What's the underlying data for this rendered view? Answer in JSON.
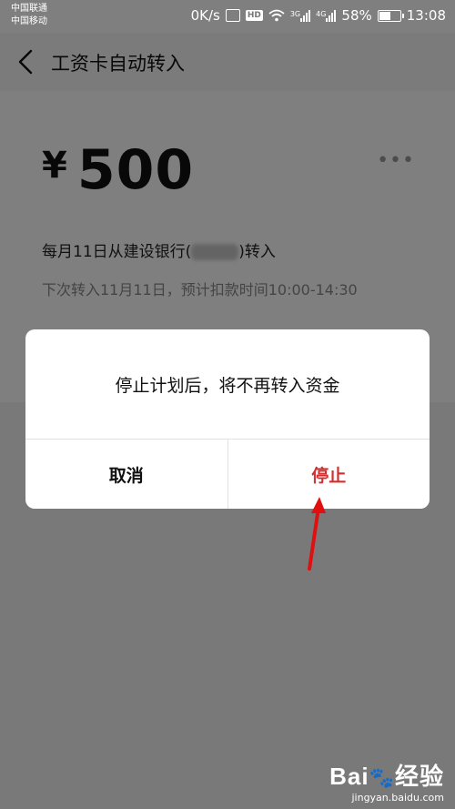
{
  "status_bar": {
    "carrier_1": "中国联通",
    "carrier_2": "中国移动",
    "net_speed": "0K/s",
    "hd_label": "HD",
    "sig1_label": "3G",
    "sig2_label": "4G",
    "battery_percent": "58%",
    "time": "13:08",
    "icons": [
      "vibrate-icon",
      "hd-icon",
      "wifi-icon",
      "signal-3g-icon",
      "signal-4g-icon",
      "battery-icon"
    ]
  },
  "navbar": {
    "back_icon": "chevron-left-icon",
    "title": "工资卡自动转入"
  },
  "plan": {
    "currency": "¥",
    "amount": "500",
    "more_label": "•••",
    "desc_prefix": "每月11日从建设银行(",
    "desc_suffix": ")转入",
    "next_info": "下次转入11月11日，预计扣款时间10:00-14:30"
  },
  "dialog": {
    "message": "停止计划后，将不再转入资金",
    "cancel_label": "取消",
    "stop_label": "停止"
  },
  "watermark": {
    "logo_text": "Bai",
    "logo_suffix": "经验",
    "url": "jingyan.baidu.com"
  },
  "colors": {
    "stop_button": "#d03030",
    "annotation_arrow": "#e01010",
    "overlay": "rgba(0,0,0,0.5)"
  }
}
